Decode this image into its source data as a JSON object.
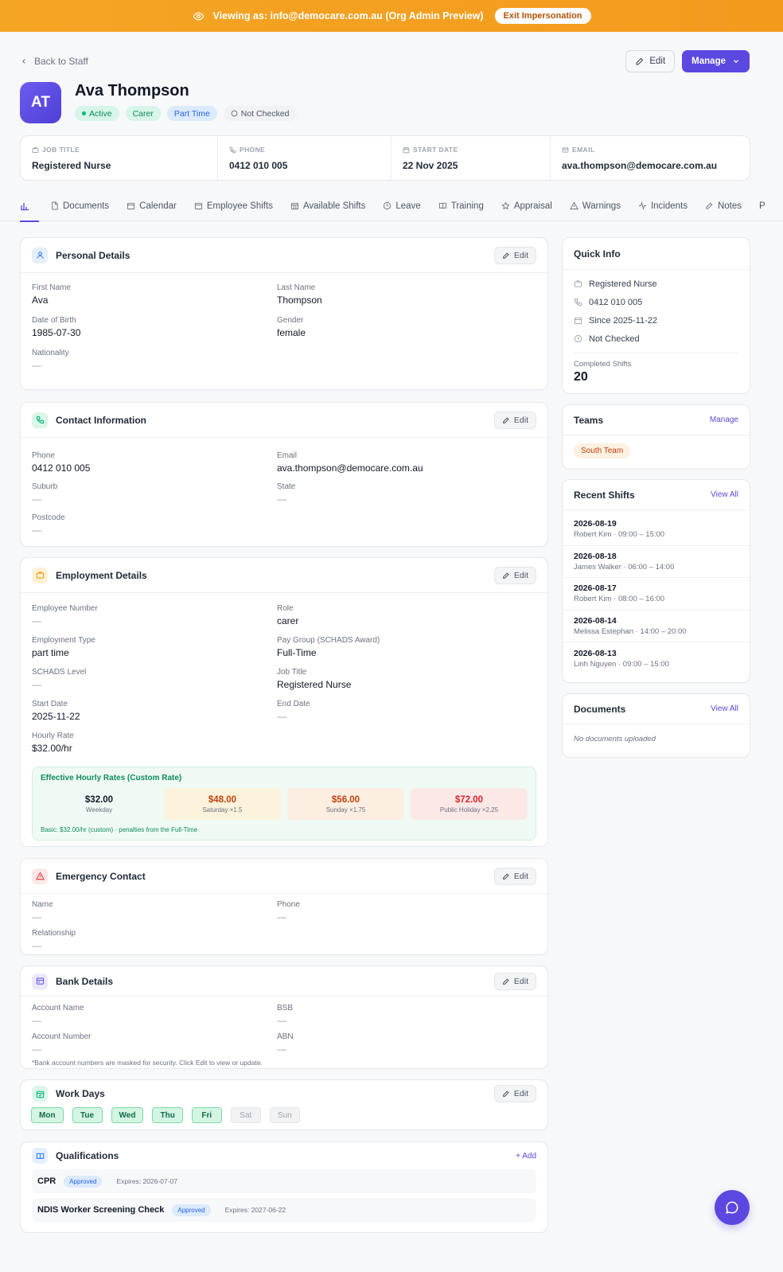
{
  "banner": {
    "text": "Viewing as: info@democare.com.au (Org Admin Preview)",
    "exit_label": "Exit Impersonation"
  },
  "nav": {
    "back_label": "Back to Staff",
    "edit_label": "Edit",
    "manage_label": "Manage"
  },
  "profile": {
    "initials": "AT",
    "name": "Ava Thompson",
    "badges": [
      "Active",
      "Carer",
      "Part Time",
      "Not Checked"
    ]
  },
  "infobar": {
    "job_title_label": "JOB TITLE",
    "job_title": "Registered Nurse",
    "phone_label": "PHONE",
    "phone": "0412 010 005",
    "start_label": "START DATE",
    "start": "22 Nov 2025",
    "email_label": "EMAIL",
    "email": "ava.thompson@democare.com.au"
  },
  "tabs": [
    "Documents",
    "Calendar",
    "Employee Shifts",
    "Available Shifts",
    "Leave",
    "Training",
    "Appraisal",
    "Warnings",
    "Incidents",
    "Notes",
    "P"
  ],
  "personal": {
    "title": "Personal Details",
    "edit": "Edit",
    "first_name_label": "First Name",
    "first_name": "Ava",
    "last_name_label": "Last Name",
    "last_name": "Thompson",
    "dob_label": "Date of Birth",
    "dob": "1985-07-30",
    "gender_label": "Gender",
    "gender": "female",
    "nationality_label": "Nationality",
    "nationality": "—"
  },
  "contact": {
    "title": "Contact Information",
    "edit": "Edit",
    "phone_label": "Phone",
    "phone": "0412 010 005",
    "email_label": "Email",
    "email": "ava.thompson@democare.com.au",
    "suburb_label": "Suburb",
    "suburb": "—",
    "state_label": "State",
    "state": "—",
    "postcode_label": "Postcode",
    "postcode": "—"
  },
  "employment": {
    "title": "Employment Details",
    "edit": "Edit",
    "emp_no_label": "Employee Number",
    "emp_no": "—",
    "role_label": "Role",
    "role": "carer",
    "type_label": "Employment Type",
    "type": "part time",
    "pay_group_label": "Pay Group (SCHADS Award)",
    "pay_group": "Full-Time",
    "schads_label": "SCHADS Level",
    "schads": "—",
    "job_title_label": "Job Title",
    "job_title": "Registered Nurse",
    "start_label": "Start Date",
    "start": "2025-11-22",
    "end_label": "End Date",
    "end": "—",
    "rate_label": "Hourly Rate",
    "rate": "$32.00/hr",
    "rates_title": "Effective Hourly Rates (Custom Rate)",
    "rates": [
      {
        "amount": "$32.00",
        "label": "Weekday",
        "color": "#111827",
        "bg": "#effaf4"
      },
      {
        "amount": "$48.00",
        "label": "Saturday ×1.5",
        "color": "#c2410c",
        "bg": "#fdf3dc"
      },
      {
        "amount": "$56.00",
        "label": "Sunday ×1.75",
        "color": "#c2410c",
        "bg": "#fdeee2"
      },
      {
        "amount": "$72.00",
        "label": "Public Holiday ×2.25",
        "color": "#dc2626",
        "bg": "#fde8e8"
      }
    ],
    "rates_note": "Basic: $32.00/hr (custom) · penalties from the Full-Time"
  },
  "emergency": {
    "title": "Emergency Contact",
    "edit": "Edit",
    "name_label": "Name",
    "name": "—",
    "phone_label": "Phone",
    "phone": "—",
    "rel_label": "Relationship",
    "rel": "—"
  },
  "bank": {
    "title": "Bank Details",
    "edit": "Edit",
    "acc_name_label": "Account Name",
    "acc_name": "—",
    "bsb_label": "BSB",
    "bsb": "—",
    "acc_no_label": "Account Number",
    "acc_no": "—",
    "abn_label": "ABN",
    "abn": "—",
    "note": "*Bank account numbers are masked for security. Click Edit to view or update."
  },
  "workdays": {
    "title": "Work Days",
    "edit": "Edit",
    "days": [
      "Mon",
      "Tue",
      "Wed",
      "Thu",
      "Fri",
      "Sat",
      "Sun"
    ]
  },
  "qualifications": {
    "title": "Qualifications",
    "add": "+ Add",
    "items": [
      {
        "name": "CPR",
        "status": "Approved",
        "expires": "Expires: 2026-07-07"
      },
      {
        "name": "NDIS Worker Screening Check",
        "status": "Approved",
        "expires": "Expires: 2027-06-22"
      }
    ]
  },
  "quick_info": {
    "title": "Quick Info",
    "job": "Registered Nurse",
    "phone": "0412 010 005",
    "since": "Since 2025-11-22",
    "check": "Not Checked",
    "completed_label": "Completed Shifts",
    "completed": "20"
  },
  "teams": {
    "title": "Teams",
    "manage": "Manage",
    "team": "South Team"
  },
  "recent_shifts": {
    "title": "Recent Shifts",
    "view_all": "View All",
    "items": [
      {
        "date": "2026-08-19",
        "detail": "Robert Kim · 09:00 – 15:00"
      },
      {
        "date": "2026-08-18",
        "detail": "James Walker · 06:00 – 14:00"
      },
      {
        "date": "2026-08-17",
        "detail": "Robert Kim · 08:00 – 16:00"
      },
      {
        "date": "2026-08-14",
        "detail": "Melissa Estephan · 14:00 – 20:00"
      },
      {
        "date": "2026-08-13",
        "detail": "Linh Nguyen · 09:00 – 15:00"
      }
    ]
  },
  "documents": {
    "title": "Documents",
    "view_all": "View All",
    "empty": "No documents uploaded"
  },
  "colors": {
    "accent": "#5b48e0",
    "banner": "#f5a524",
    "success": "#0f8a5f"
  }
}
